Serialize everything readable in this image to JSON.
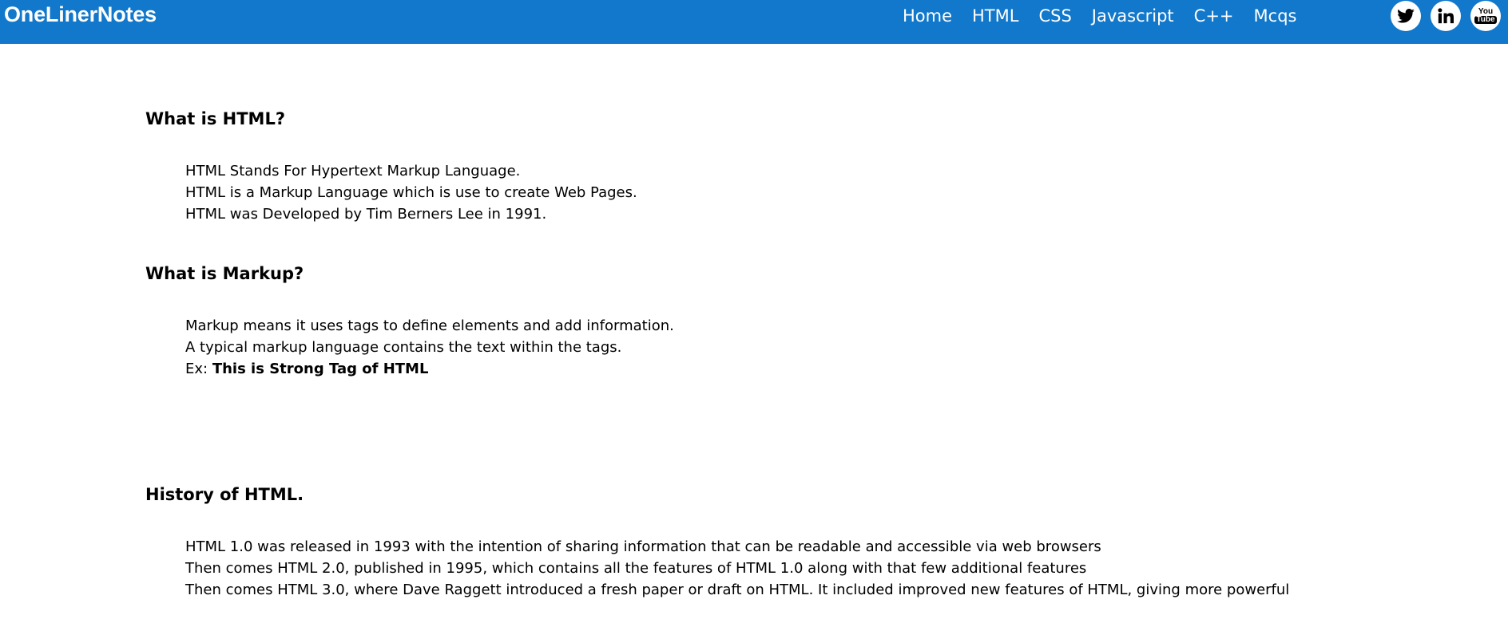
{
  "brand": {
    "name": "OneLinerNotes",
    "color": "#1178cb"
  },
  "nav": {
    "items": [
      {
        "label": "Home"
      },
      {
        "label": "HTML"
      },
      {
        "label": "CSS"
      },
      {
        "label": "Javascript"
      },
      {
        "label": "C++"
      },
      {
        "label": "Mcqs"
      }
    ]
  },
  "social": {
    "icons": [
      "twitter-icon",
      "linkedin-icon",
      "youtube-icon"
    ],
    "youtube_top": "You",
    "youtube_bottom": "Tube"
  },
  "sections": [
    {
      "title": "What is HTML?",
      "points": [
        "HTML Stands For Hypertext Markup Language.",
        "HTML is a Markup Language which is use to create Web Pages.",
        "HTML was Developed by Tim Berners Lee in 1991."
      ]
    },
    {
      "title": "What is Markup?",
      "points": [
        "Markup means it uses tags to define elements and add information.",
        "A typical markup language contains the text within the tags."
      ],
      "example_prefix": "Ex: ",
      "example_strong": "This is Strong Tag of HTML"
    },
    {
      "title": "History of HTML.",
      "points": [
        "HTML 1.0 was released in 1993 with the intention of sharing information that can be readable and accessible via web browsers",
        "Then comes HTML 2.0, published in 1995, which contains all the features of HTML 1.0 along with that few additional features",
        "Then comes HTML 3.0, where Dave Raggett introduced a fresh paper or draft on HTML. It included improved new features of HTML, giving more powerful"
      ]
    }
  ]
}
